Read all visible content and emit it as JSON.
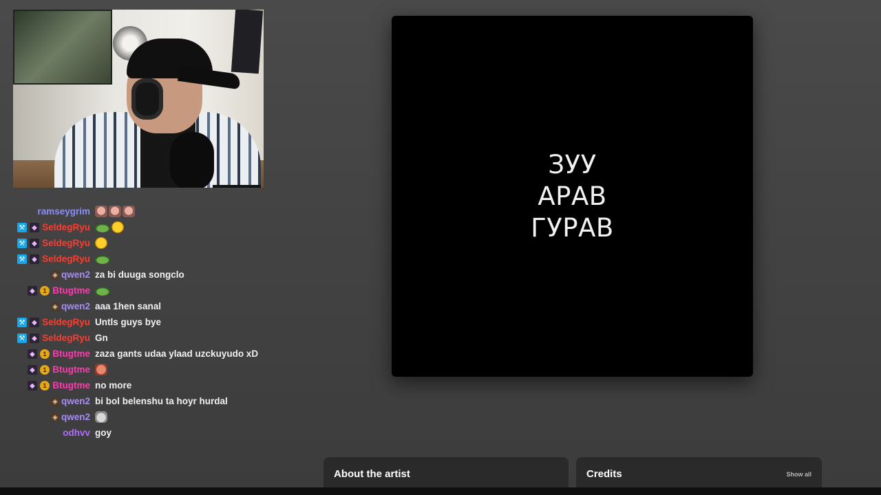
{
  "webcam": {
    "label": "Streamer webcam feed"
  },
  "chat": {
    "messages": [
      {
        "user": "ramseygrim",
        "user_color": "#8c8cff",
        "badges": [],
        "text": "",
        "emotes": [
          "face",
          "face",
          "face"
        ]
      },
      {
        "user": "SeldegRyu",
        "user_color": "#ff3b2f",
        "badges": [
          "mod",
          "vip"
        ],
        "text": "",
        "emotes": [
          "frog",
          "chick"
        ]
      },
      {
        "user": "SeldegRyu",
        "user_color": "#ff3b2f",
        "badges": [
          "mod",
          "vip"
        ],
        "text": "",
        "emotes": [
          "chick"
        ]
      },
      {
        "user": "SeldegRyu",
        "user_color": "#ff3b2f",
        "badges": [
          "mod",
          "vip"
        ],
        "text": "",
        "emotes": [
          "frog"
        ]
      },
      {
        "user": "qwen2",
        "user_color": "#a78bfa",
        "badges": [
          "art"
        ],
        "text": "za bi duuga songclo",
        "emotes": []
      },
      {
        "user": "Btugtme",
        "user_color": "#ff3bb0",
        "badges": [
          "vip",
          "sub"
        ],
        "text": "",
        "emotes": [
          "frog"
        ]
      },
      {
        "user": "qwen2",
        "user_color": "#a78bfa",
        "badges": [
          "art"
        ],
        "text": "aaa 1hen sanal",
        "emotes": []
      },
      {
        "user": "SeldegRyu",
        "user_color": "#ff3b2f",
        "badges": [
          "mod",
          "vip"
        ],
        "text": "Untls guys bye",
        "emotes": []
      },
      {
        "user": "SeldegRyu",
        "user_color": "#ff3b2f",
        "badges": [
          "mod",
          "vip"
        ],
        "text": "Gn",
        "emotes": []
      },
      {
        "user": "Btugtme",
        "user_color": "#ff3bb0",
        "badges": [
          "vip",
          "sub"
        ],
        "text": "zaza gants udaa ylaad uzckuyudo xD",
        "emotes": []
      },
      {
        "user": "Btugtme",
        "user_color": "#ff3bb0",
        "badges": [
          "vip",
          "sub"
        ],
        "text": "",
        "emotes": [
          "rage"
        ]
      },
      {
        "user": "Btugtme",
        "user_color": "#ff3bb0",
        "badges": [
          "vip",
          "sub"
        ],
        "text": "no more",
        "emotes": []
      },
      {
        "user": "qwen2",
        "user_color": "#a78bfa",
        "badges": [
          "art"
        ],
        "text": "bi bol belenshu ta hoyr hurdal",
        "emotes": []
      },
      {
        "user": "qwen2",
        "user_color": "#a78bfa",
        "badges": [
          "art"
        ],
        "text": "",
        "emotes": [
          "cat"
        ]
      },
      {
        "user": "odhvv",
        "user_color": "#b36bff",
        "badges": [],
        "text": "goy",
        "emotes": []
      }
    ]
  },
  "album": {
    "title_lines": [
      "ЗУУ",
      "АРАВ",
      "ГУРАВ"
    ]
  },
  "panels": {
    "about_title": "About the artist",
    "credits_title": "Credits",
    "credits_link": "Show all"
  },
  "sub_badge_label": "1"
}
